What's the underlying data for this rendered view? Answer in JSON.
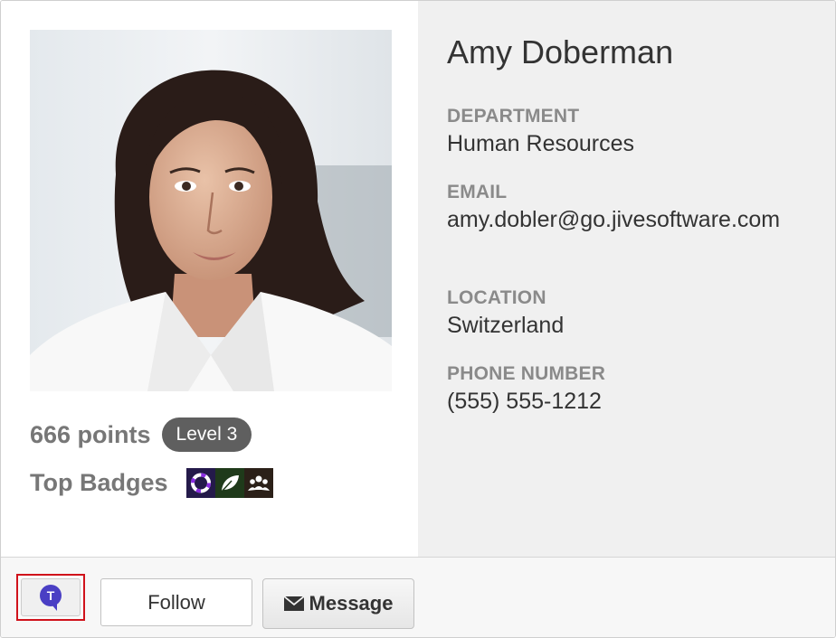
{
  "profile": {
    "name": "Amy Doberman",
    "points": "666 points",
    "level": "Level 3",
    "top_badges_label": "Top Badges",
    "badges": [
      "lifebuoy-badge-icon",
      "leaf-badge-icon",
      "people-badge-icon"
    ],
    "fields": [
      {
        "label": "DEPARTMENT",
        "value": "Human Resources"
      },
      {
        "label": "EMAIL",
        "value": "amy.dobler@go.jivesoftware.com"
      },
      {
        "label": "LOCATION",
        "value": "Switzerland"
      },
      {
        "label": "PHONE NUMBER",
        "value": "(555) 555-1212"
      }
    ]
  },
  "actions": {
    "chat_icon": "chat-bubble-icon",
    "chat_letter": "T",
    "follow_label": "Follow",
    "message_icon": "envelope-icon",
    "message_label": "Message"
  },
  "colors": {
    "chat_highlight_border": "#d0121b",
    "chat_bubble": "#4a3fc4",
    "level_pill": "#5f5f5f",
    "right_panel_bg": "#f0f0f0"
  }
}
